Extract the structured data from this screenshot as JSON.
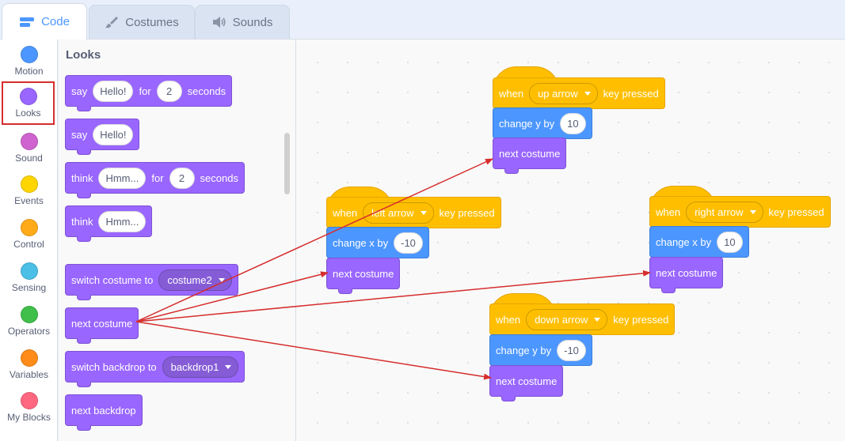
{
  "tabs": [
    {
      "label": "Code",
      "icon": "code-icon",
      "active": true
    },
    {
      "label": "Costumes",
      "icon": "brush-icon",
      "active": false
    },
    {
      "label": "Sounds",
      "icon": "speaker-icon",
      "active": false
    }
  ],
  "categories": [
    {
      "label": "Motion",
      "color": "#4c97ff"
    },
    {
      "label": "Looks",
      "color": "#9966ff"
    },
    {
      "label": "Sound",
      "color": "#cf63cf"
    },
    {
      "label": "Events",
      "color": "#ffd500"
    },
    {
      "label": "Control",
      "color": "#ffab19"
    },
    {
      "label": "Sensing",
      "color": "#4cbfe6"
    },
    {
      "label": "Operators",
      "color": "#40bf4a"
    },
    {
      "label": "Variables",
      "color": "#ff8c1a"
    },
    {
      "label": "My Blocks",
      "color": "#ff6680"
    }
  ],
  "palette": {
    "title": "Looks",
    "say_for": {
      "say": "say",
      "msg": "Hello!",
      "for": "for",
      "secs": "2",
      "seconds": "seconds"
    },
    "say": {
      "say": "say",
      "msg": "Hello!"
    },
    "think_for": {
      "think": "think",
      "msg": "Hmm...",
      "for": "for",
      "secs": "2",
      "seconds": "seconds"
    },
    "think": {
      "think": "think",
      "msg": "Hmm..."
    },
    "switch_costume": {
      "label": "switch costume to",
      "value": "costume2"
    },
    "next_costume": "next costume",
    "switch_backdrop": {
      "label": "switch backdrop to",
      "value": "backdrop1"
    },
    "next_backdrop": "next backdrop"
  },
  "scripts": {
    "up": {
      "when": "when",
      "key": "up arrow",
      "pressed": "key pressed",
      "motion": "change y by",
      "value": "10",
      "looks": "next costume"
    },
    "left": {
      "when": "when",
      "key": "left arrow",
      "pressed": "key pressed",
      "motion": "change x by",
      "value": "-10",
      "looks": "next costume"
    },
    "right": {
      "when": "when",
      "key": "right arrow",
      "pressed": "key pressed",
      "motion": "change x by",
      "value": "10",
      "looks": "next costume"
    },
    "down": {
      "when": "when",
      "key": "down arrow",
      "pressed": "key pressed",
      "motion": "change y by",
      "value": "-10",
      "looks": "next costume"
    }
  },
  "colors": {
    "annotation_arrow": "#d62d2d",
    "looks": "#9966ff",
    "motion": "#4c97ff",
    "events": "#ffbf00"
  }
}
